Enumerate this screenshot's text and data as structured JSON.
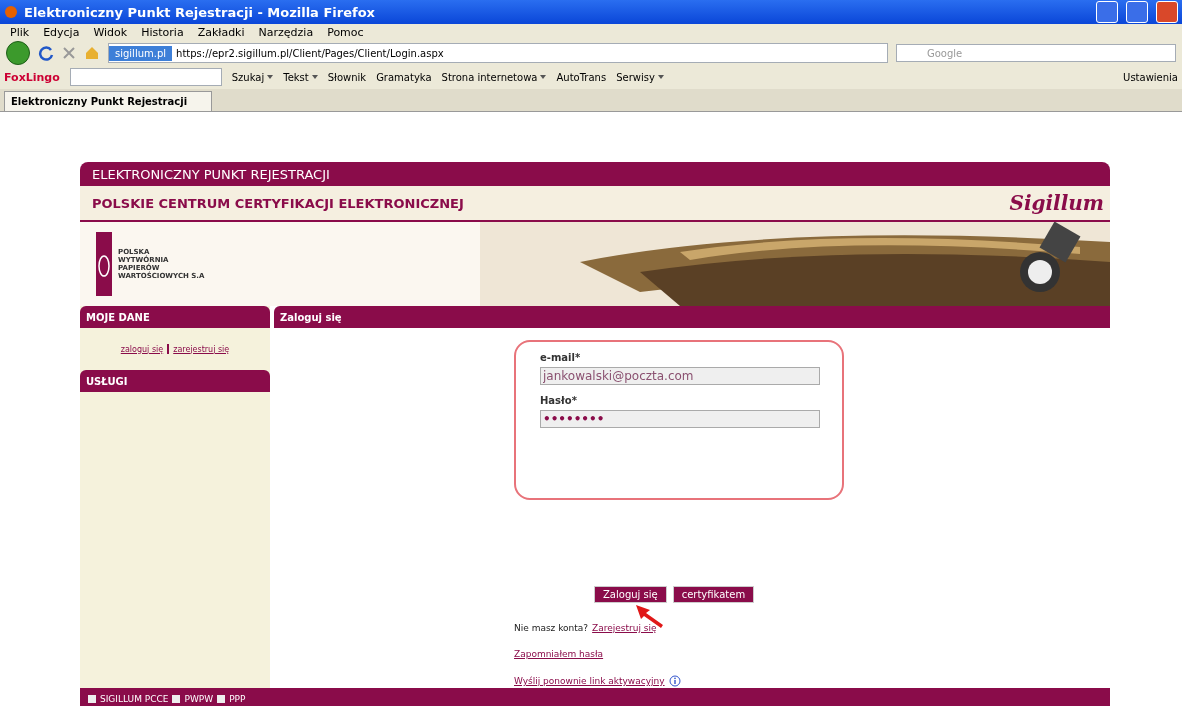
{
  "window": {
    "title": "Elektroniczny Punkt Rejestracji - Mozilla Firefox"
  },
  "menu": [
    "Plik",
    "Edycja",
    "Widok",
    "Historia",
    "Zakładki",
    "Narzędzia",
    "Pomoc"
  ],
  "navbar": {
    "site_identity": "sigillum.pl",
    "url": "https://epr2.sigillum.pl/Client/Pages/Client/Login.aspx",
    "search_placeholder": "Google"
  },
  "toolbar": {
    "brand": "FoxLingo",
    "items": [
      {
        "label": "Szukaj",
        "dropdown": true
      },
      {
        "label": "Tekst",
        "dropdown": true
      },
      {
        "label": "Słownik",
        "dropdown": false
      },
      {
        "label": "Gramatyka",
        "dropdown": false
      },
      {
        "label": "Strona internetowa",
        "dropdown": true
      },
      {
        "label": "AutoTrans",
        "dropdown": false
      },
      {
        "label": "Serwisy",
        "dropdown": true
      }
    ],
    "settings": "Ustawienia"
  },
  "tabs": [
    {
      "label": "Elektroniczny Punkt Rejestracji",
      "selected": true
    }
  ],
  "page": {
    "top_bar": "ELEKTRONICZNY PUNKT REJESTRACJI",
    "subtitle": "POLSKIE CENTRUM CERTYFIKACJI ELEKTRONICZNEJ",
    "brand": "Sigillum",
    "logo_lines": [
      "POLSKA",
      "WYTWÓRNIA",
      "PAPIERÓW",
      "WARTOŚCIOWYCH S.A"
    ],
    "sidebar": {
      "my_data": "MOJE DANE",
      "links": [
        "zaloguj się",
        "zarejestruj się"
      ],
      "services": "USŁUGI"
    },
    "content_title": "Zaloguj się",
    "form": {
      "email_label": "e-mail*",
      "email_value": "jankowalski@poczta.com",
      "password_label": "Hasło*",
      "password_value": "••••••••"
    },
    "buttons": [
      "Zaloguj się",
      "certyfikatem"
    ],
    "no_account": "Nie masz konta?",
    "register_link": "Zarejestruj się",
    "forgot_link": "Zapomniałem hasła",
    "resend_link": "Wyślij ponownie link aktywacyjny",
    "footer": [
      "SIGILLUM PCCE",
      "PWPW",
      "PPP"
    ]
  }
}
